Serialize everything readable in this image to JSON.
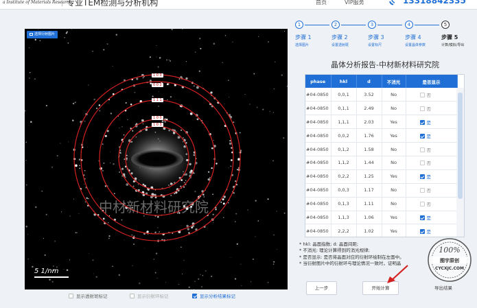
{
  "header": {
    "brand": "a Institute of Materials Research",
    "slogan": "专业TEM检测与分析机构",
    "nav_home": "首页",
    "nav_vip": "VIP服务",
    "phone": "13318842335"
  },
  "image": {
    "select_button": "选择衍射图片",
    "watermark": "中材新材料研究院",
    "scale_label": "5 1/nm",
    "ring_labels": [
      "1 0 0",
      "0 0 2",
      "1 1 1",
      "1 0 0",
      "1 0 3"
    ]
  },
  "checkboxes": [
    {
      "label": "显示透射斑标记",
      "checked": false
    },
    {
      "label": "显示衍射环标记",
      "checked": false
    },
    {
      "label": "显示分析结果标记",
      "checked": true
    }
  ],
  "steps": [
    {
      "num": "1",
      "title": "步骤 1",
      "desc": "选择图片"
    },
    {
      "num": "2",
      "title": "步骤 2",
      "desc": "设置透射斑"
    },
    {
      "num": "3",
      "title": "步骤 3",
      "desc": "设置标尺"
    },
    {
      "num": "4",
      "title": "步骤 4",
      "desc": "设置晶体参数"
    },
    {
      "num": "5",
      "title": "步骤 5",
      "desc": "计算/模拟/导出"
    }
  ],
  "report": {
    "title": "晶体分析报告-中材新材料研究院",
    "columns": [
      "phase",
      "hkl",
      "d",
      "不消光",
      "是否显示"
    ],
    "rows": [
      {
        "phase": "#04-0850",
        "hkl": "0,0,1",
        "d": "3.52",
        "extinct": "No",
        "show": "否",
        "checked": false
      },
      {
        "phase": "#04-0850",
        "hkl": "0,1,1",
        "d": "2.49",
        "extinct": "No",
        "show": "否",
        "checked": false
      },
      {
        "phase": "#04-0850",
        "hkl": "1,1,1",
        "d": "2.03",
        "extinct": "Yes",
        "show": "是",
        "checked": true
      },
      {
        "phase": "#04-0850",
        "hkl": "0,0,2",
        "d": "1.76",
        "extinct": "Yes",
        "show": "是",
        "checked": true
      },
      {
        "phase": "#04-0850",
        "hkl": "0,1,2",
        "d": "1.58",
        "extinct": "No",
        "show": "否",
        "checked": false
      },
      {
        "phase": "#04-0850",
        "hkl": "1,1,2",
        "d": "1.44",
        "extinct": "No",
        "show": "否",
        "checked": false
      },
      {
        "phase": "#04-0850",
        "hkl": "0,2,2",
        "d": "1.25",
        "extinct": "Yes",
        "show": "是",
        "checked": true
      },
      {
        "phase": "#04-0850",
        "hkl": "0,0,3",
        "d": "1.17",
        "extinct": "No",
        "show": "否",
        "checked": false
      },
      {
        "phase": "#04-0850",
        "hkl": "0,1,3",
        "d": "1.11",
        "extinct": "No",
        "show": "否",
        "checked": false
      },
      {
        "phase": "#04-0850",
        "hkl": "1,1,3",
        "d": "1.06",
        "extinct": "Yes",
        "show": "是",
        "checked": true
      },
      {
        "phase": "#04-0850",
        "hkl": "2,2,2",
        "d": "1.02",
        "extinct": "Yes",
        "show": "是",
        "checked": true
      }
    ]
  },
  "notes": [
    "* hkl: 晶面指数;  d: 晶面间距;",
    "* 不消光: 理论计算得到的消光规律;",
    "* 是否显示: 是否将晶面对应的衍射环绘制在左面中。",
    "* 当衍射图片中的衍射环与理论情况一致时，证明晶"
  ],
  "buttons": {
    "prev": "上一步",
    "start": "开始计算",
    "export": "导出结果"
  },
  "stamp": {
    "percent": "100%",
    "brand": "图宇原创",
    "site": "CYCXJC.COM"
  },
  "colors": {
    "accent": "#1f6fd6",
    "ring": "#d42020"
  }
}
